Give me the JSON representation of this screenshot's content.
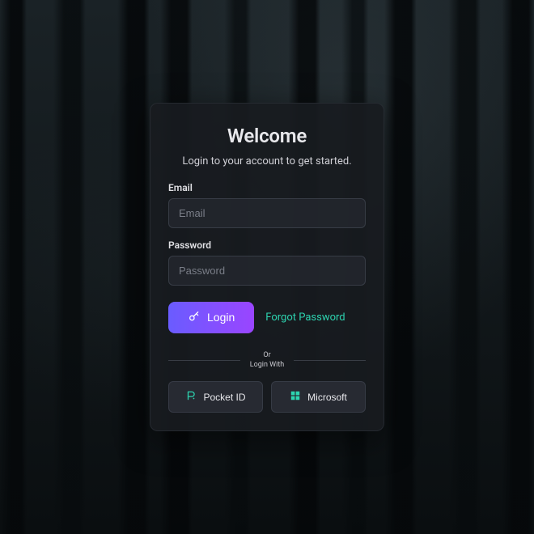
{
  "card": {
    "title": "Welcome",
    "subtitle": "Login to your account to get started."
  },
  "form": {
    "email": {
      "label": "Email",
      "placeholder": "Email",
      "value": ""
    },
    "password": {
      "label": "Password",
      "placeholder": "Password",
      "value": ""
    }
  },
  "actions": {
    "login_label": "Login",
    "forgot_label": "Forgot Password"
  },
  "divider": {
    "line1": "Or",
    "line2": "Login With"
  },
  "oauth": {
    "pocketid_label": "Pocket ID",
    "microsoft_label": "Microsoft"
  },
  "colors": {
    "accent_start": "#6a5cff",
    "accent_end": "#9a45ff",
    "link": "#2dd4b0",
    "oauth_pocketid_icon": "#2dd4b0",
    "oauth_microsoft_icon": "#2dd4b0"
  }
}
